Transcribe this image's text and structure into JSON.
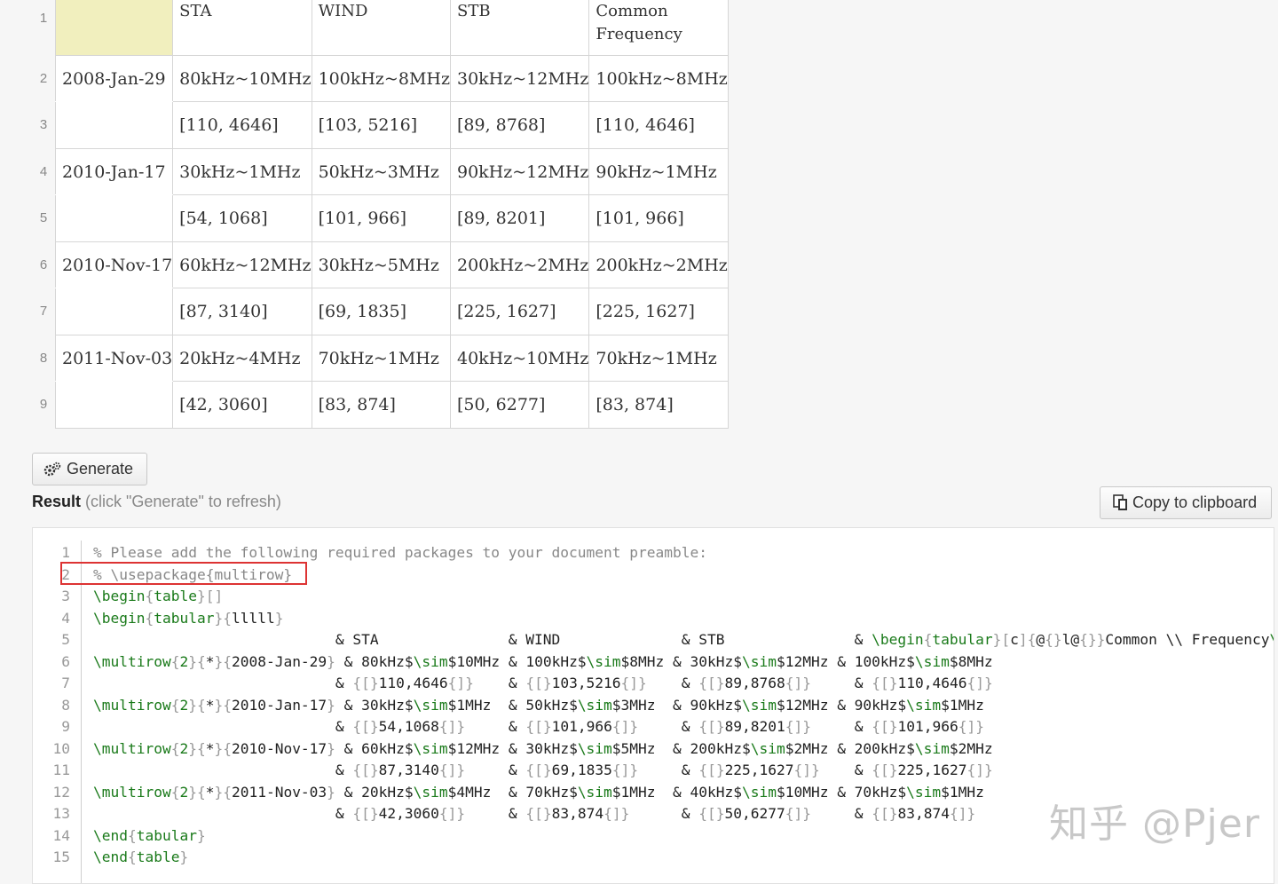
{
  "sheet": {
    "row_numbers": [
      "1",
      "2",
      "3",
      "4",
      "5",
      "6",
      "7",
      "8",
      "9"
    ],
    "header": [
      "",
      "STA",
      "WIND",
      "STB",
      "Common Frequency"
    ],
    "rows": [
      [
        "2008-Jan-29",
        "80kHz~10MHz",
        "100kHz~8MHz",
        "30kHz~12MHz",
        "100kHz~8MHz"
      ],
      [
        "",
        "[110, 4646]",
        "[103, 5216]",
        "[89, 8768]",
        "[110, 4646]"
      ],
      [
        "2010-Jan-17",
        "30kHz~1MHz",
        "50kHz~3MHz",
        "90kHz~12MHz",
        "90kHz~1MHz"
      ],
      [
        "",
        "[54, 1068]",
        "[101, 966]",
        "[89, 8201]",
        "[101, 966]"
      ],
      [
        "2010-Nov-17",
        "60kHz~12MHz",
        "30kHz~5MHz",
        "200kHz~2MHz",
        "200kHz~2MHz"
      ],
      [
        "",
        "[87, 3140]",
        "[69, 1835]",
        "[225, 1627]",
        "[225, 1627]"
      ],
      [
        "2011-Nov-03",
        "20kHz~4MHz",
        "70kHz~1MHz",
        "40kHz~10MHz",
        "70kHz~1MHz"
      ],
      [
        "",
        "[42, 3060]",
        "[83, 874]",
        "[50, 6277]",
        "[83, 874]"
      ]
    ],
    "header_cell_color": "#f1efbe"
  },
  "toolbar": {
    "generate_label": "Generate",
    "copy_label": "Copy to clipboard"
  },
  "result": {
    "label": "Result",
    "hint": "(click \"Generate\" to refresh)"
  },
  "code": {
    "lines": [
      "% Please add the following required packages to your document preamble:",
      "% \\usepackage{multirow}",
      "\\begin{table}[]",
      "\\begin{tabular}{lllll}",
      "                            & STA               & WIND              & STB               & \\begin{tabular}[c]{@{}l@{}}Common \\\\ Frequency\\e",
      "\\multirow{2}{*}{2008-Jan-29} & 80kHz$\\sim$10MHz & 100kHz$\\sim$8MHz & 30kHz$\\sim$12MHz & 100kHz$\\sim$8MHz",
      "                            & {[}110,4646{]}    & {[}103,5216{]}    & {[}89,8768{]}     & {[}110,4646{]}",
      "\\multirow{2}{*}{2010-Jan-17} & 30kHz$\\sim$1MHz  & 50kHz$\\sim$3MHz  & 90kHz$\\sim$12MHz & 90kHz$\\sim$1MHz",
      "                            & {[}54,1068{]}     & {[}101,966{]}     & {[}89,8201{]}     & {[}101,966{]}",
      "\\multirow{2}{*}{2010-Nov-17} & 60kHz$\\sim$12MHz & 30kHz$\\sim$5MHz  & 200kHz$\\sim$2MHz & 200kHz$\\sim$2MHz",
      "                            & {[}87,3140{]}     & {[}69,1835{]}     & {[}225,1627{]}    & {[}225,1627{]}",
      "\\multirow{2}{*}{2011-Nov-03} & 20kHz$\\sim$4MHz  & 70kHz$\\sim$1MHz  & 40kHz$\\sim$10MHz & 70kHz$\\sim$1MHz",
      "                            & {[}42,3060{]}     & {[}83,874{]}      & {[}50,6277{]}     & {[}83,874{]}",
      "\\end{tabular}",
      "\\end{table}"
    ]
  },
  "watermark": "知乎 @Pjer",
  "colors": {
    "code_command": "#1a7a1a",
    "code_comment": "#888888",
    "highlight_box": "#dd3333"
  }
}
